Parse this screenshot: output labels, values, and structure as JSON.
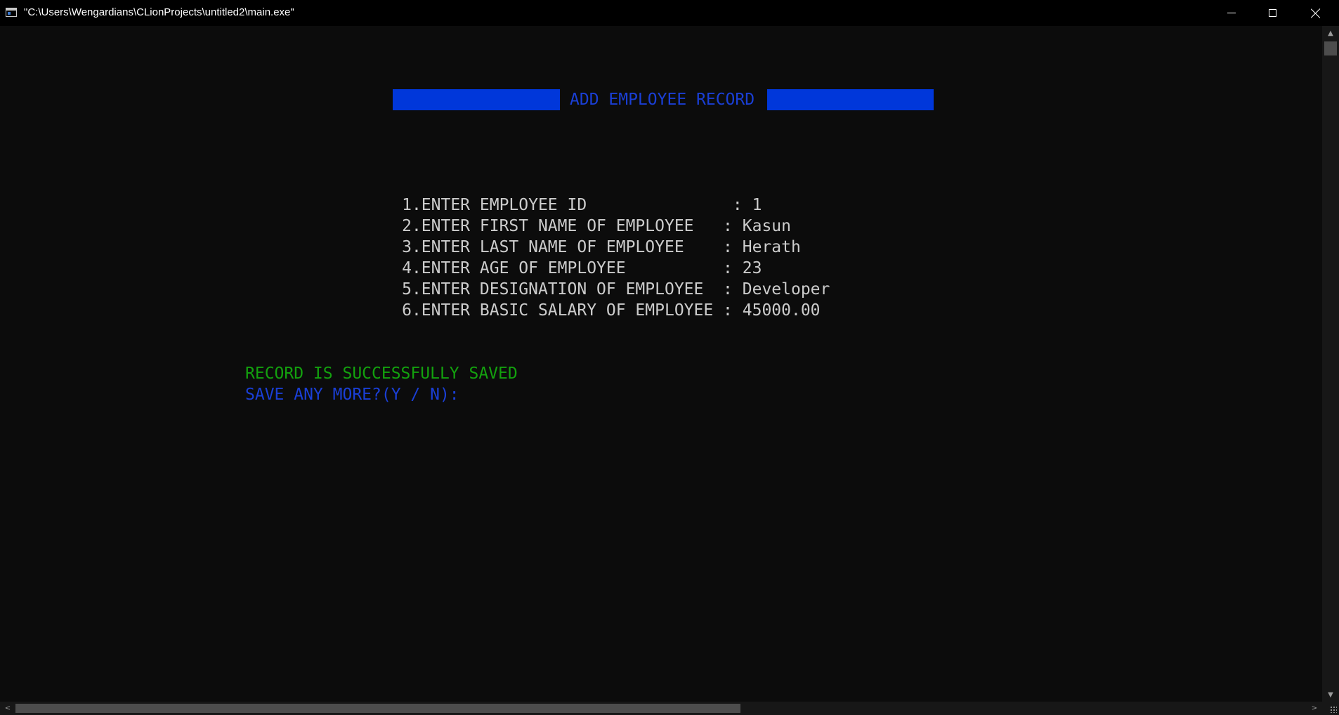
{
  "window": {
    "title": "\"C:\\Users\\Wengardians\\CLionProjects\\untitled2\\main.exe\"",
    "controls": {
      "minimize": "minimize-icon",
      "maximize": "maximize-icon",
      "close": "close-icon"
    }
  },
  "console": {
    "header_title": "ADD EMPLOYEE RECORD",
    "fields": [
      {
        "prompt": "1.ENTER EMPLOYEE ID               : ",
        "value": "1"
      },
      {
        "prompt": "2.ENTER FIRST NAME OF EMPLOYEE   : ",
        "value": "Kasun"
      },
      {
        "prompt": "3.ENTER LAST NAME OF EMPLOYEE    : ",
        "value": "Herath"
      },
      {
        "prompt": "4.ENTER AGE OF EMPLOYEE          : ",
        "value": "23"
      },
      {
        "prompt": "5.ENTER DESIGNATION OF EMPLOYEE  : ",
        "value": "Developer"
      },
      {
        "prompt": "6.ENTER BASIC SALARY OF EMPLOYEE : ",
        "value": "45000.00"
      }
    ],
    "success_message": "RECORD IS SUCCESSFULLY SAVED",
    "save_more_prompt": "SAVE ANY MORE?(Y / N):"
  },
  "colors": {
    "background": "#0c0c0c",
    "text": "#cccccc",
    "header_bar": "#0037da",
    "header_text": "#1a3fd6",
    "success": "#13a10e",
    "prompt_blue": "#1a3fd6"
  }
}
